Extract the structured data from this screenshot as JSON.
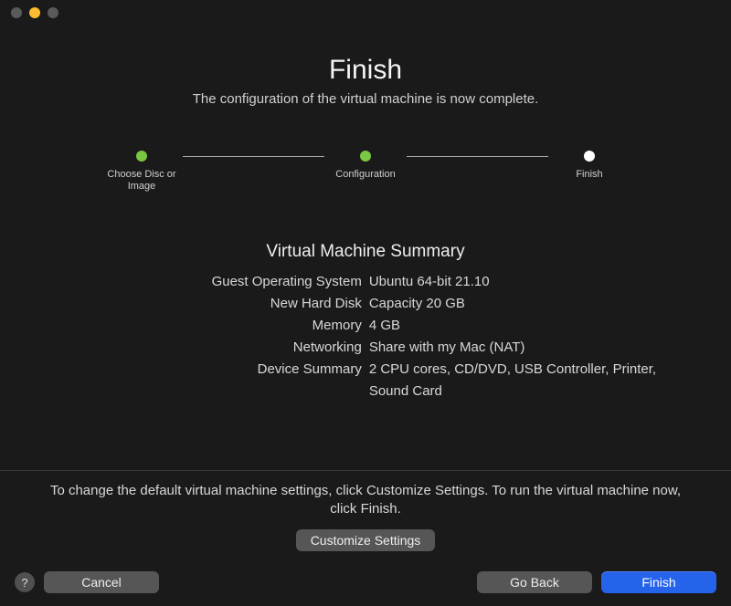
{
  "header": {
    "title": "Finish",
    "subtitle": "The configuration of the virtual machine is now complete."
  },
  "stepper": {
    "steps": [
      {
        "label": "Choose Disc or Image",
        "state": "done"
      },
      {
        "label": "Configuration",
        "state": "done"
      },
      {
        "label": "Finish",
        "state": "current"
      }
    ]
  },
  "summary": {
    "title": "Virtual Machine Summary",
    "rows": [
      {
        "label": "Guest Operating System",
        "value": "Ubuntu 64-bit 21.10"
      },
      {
        "label": "New Hard Disk",
        "value": "Capacity 20 GB"
      },
      {
        "label": "Memory",
        "value": "4 GB"
      },
      {
        "label": "Networking",
        "value": "Share with my Mac (NAT)"
      },
      {
        "label": "Device Summary",
        "value": "2 CPU cores, CD/DVD, USB Controller, Printer, Sound Card"
      }
    ]
  },
  "footer": {
    "hint": "To change the default virtual machine settings, click Customize Settings. To run the virtual machine now, click Finish.",
    "customize_label": "Customize Settings"
  },
  "buttons": {
    "help_label": "?",
    "cancel_label": "Cancel",
    "go_back_label": "Go Back",
    "finish_label": "Finish"
  }
}
